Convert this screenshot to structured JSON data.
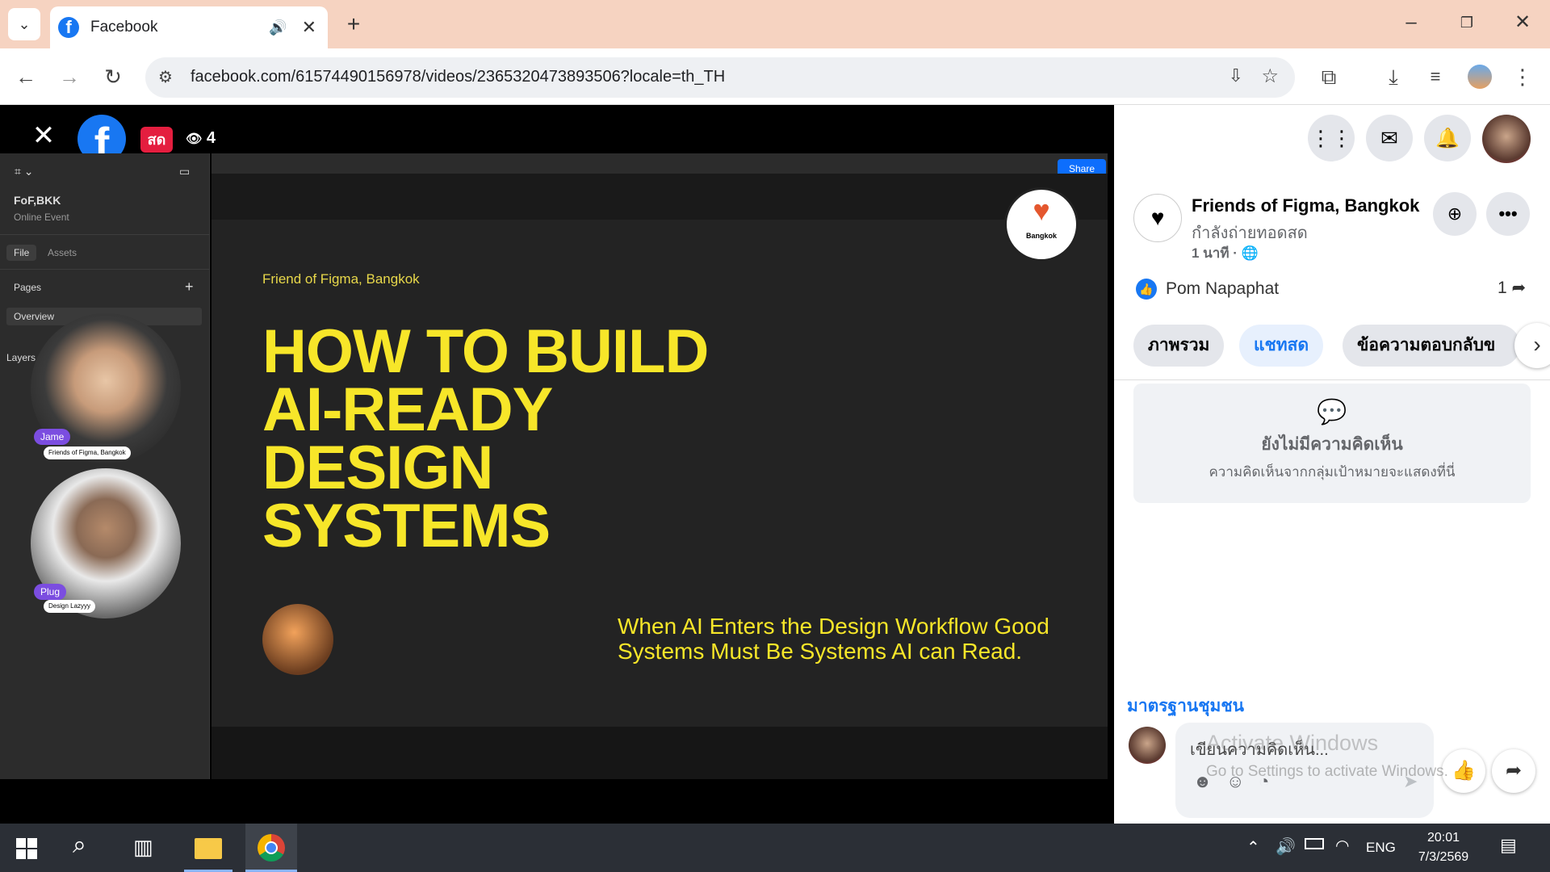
{
  "browser": {
    "tab_title": "Facebook",
    "url": "facebook.com/61574490156978/videos/2365320473893506?locale=th_TH"
  },
  "video": {
    "live_badge": "สด",
    "viewer_count": "4",
    "figma": {
      "file_name": "FoF,BKK",
      "file_sub": "Online Event",
      "tab_file": "File",
      "tab_assets": "Assets",
      "pages_label": "Pages",
      "page_item": "Overview",
      "layers_label": "Layers",
      "share": "Share"
    },
    "slide": {
      "brand": "Friend of Figma, Bangkok",
      "headline_lines": [
        "HOW TO BUILD",
        "AI-READY",
        "DESIGN",
        "SYSTEMS"
      ],
      "subline": "When AI Enters the Design Workflow Good Systems Must Be Systems AI can Read.",
      "logo_text": "Bangkok"
    },
    "speakers": [
      {
        "name": "Jame",
        "org": "Friends of Figma, Bangkok"
      },
      {
        "name": "Plug",
        "org": "Design Lazyyy"
      }
    ]
  },
  "panel": {
    "page_name": "Friends of Figma, Bangkok",
    "status": "กำลังถ่ายทอดสด",
    "time": "1 นาที ·",
    "liker": "Pom Napaphat",
    "share_count": "1",
    "tabs": [
      "ภาพรวม",
      "แชทสด",
      "ข้อความตอบกลับข"
    ],
    "empty_title": "ยังไม่มีความคิดเห็น",
    "empty_desc": "ความคิดเห็นจากกลุ่มเป้าหมายจะแสดงที่นี่",
    "community_link": "มาตรฐานชุมชน",
    "comment_placeholder": "เขียนความคิดเห็น...",
    "watermark_1": "Activate Windows",
    "watermark_2": "Go to Settings to activate Windows."
  },
  "taskbar": {
    "lang": "ENG",
    "time": "20:01",
    "date": "7/3/2569"
  },
  "colors": {
    "fb_blue": "#1877f2",
    "slide_yellow": "#f7e629",
    "live_red": "#e41e3f"
  }
}
